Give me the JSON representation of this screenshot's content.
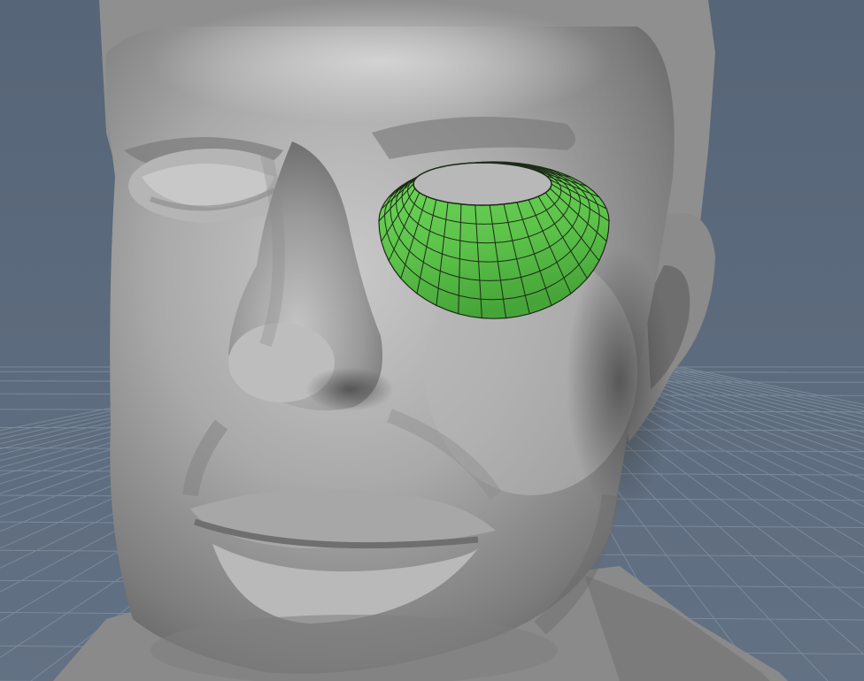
{
  "viewport": {
    "background_color": "#5b6a7c",
    "grid_color": "#8593a3",
    "model_color": "#9c9c9c",
    "selection_color": "#5cc24a",
    "wireframe_color": "#1d2a18"
  },
  "scene": {
    "model": "head-bust-mesh",
    "selection": "eye-socket-face-loop"
  }
}
